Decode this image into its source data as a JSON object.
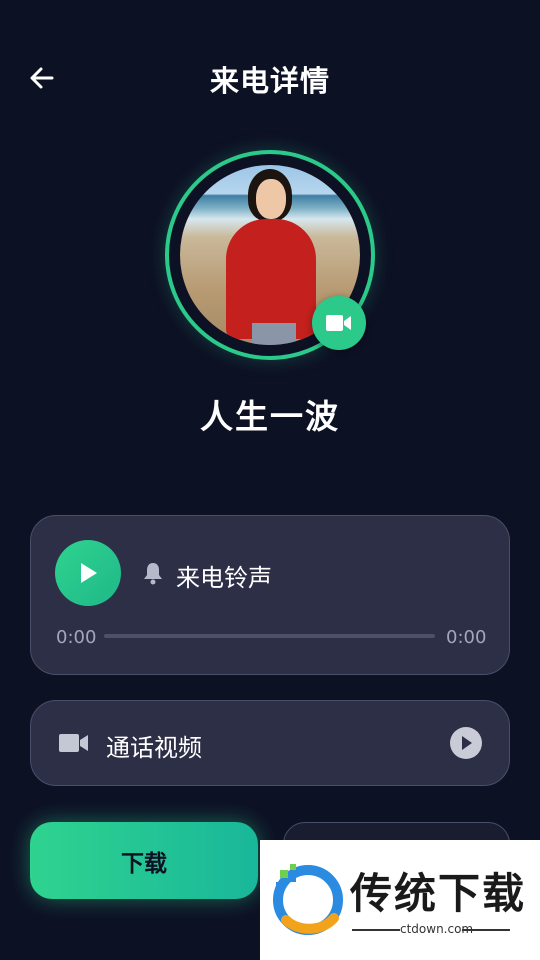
{
  "header": {
    "title": "来电详情"
  },
  "contact": {
    "name": "人生一波"
  },
  "ringtone": {
    "label": "来电铃声",
    "time_current": "0:00",
    "time_total": "0:00",
    "progress": 0
  },
  "video": {
    "label": "通话视频"
  },
  "actions": {
    "download_label": "下载"
  },
  "watermark": {
    "title": "传统下载",
    "url": "ctdown.com"
  },
  "colors": {
    "accent": "#2bc98a",
    "background": "#0d1124",
    "card": "#2c2f45"
  },
  "icons": [
    "back-arrow-icon",
    "video-camera-icon",
    "play-icon",
    "bell-icon"
  ]
}
